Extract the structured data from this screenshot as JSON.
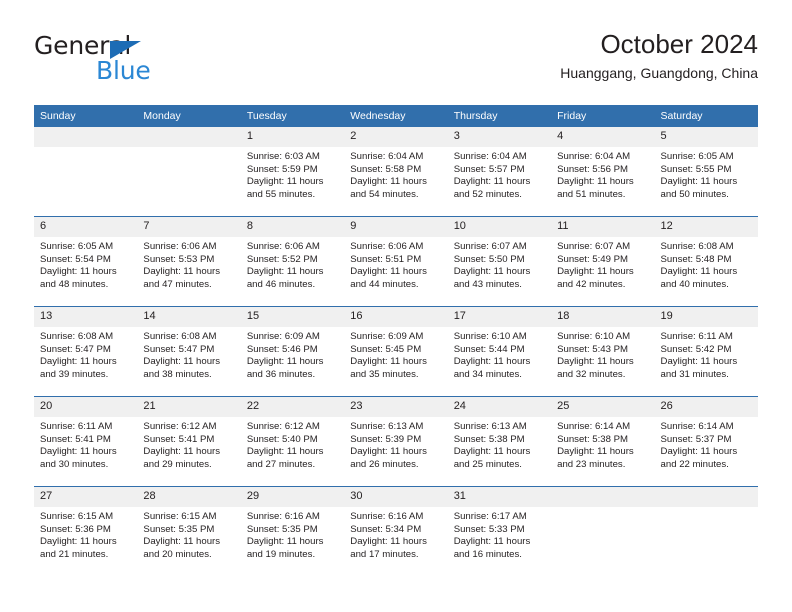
{
  "brand": {
    "name_part1": "General",
    "name_part2": "Blue",
    "flag_icon": "triangle-flag-icon"
  },
  "header": {
    "title": "October 2024",
    "subtitle": "Huanggang, Guangdong, China"
  },
  "calendar": {
    "weekday_headers": [
      "Sunday",
      "Monday",
      "Tuesday",
      "Wednesday",
      "Thursday",
      "Friday",
      "Saturday"
    ],
    "header_bg": "#316fac",
    "daynum_bg": "#f0f0f0",
    "grid_line": "#316fac",
    "labels": {
      "sunrise": "Sunrise:",
      "sunset": "Sunset:",
      "daylight": "Daylight:"
    },
    "weeks": [
      [
        {
          "day": "",
          "empty": true
        },
        {
          "day": "",
          "empty": true
        },
        {
          "day": "1",
          "sunrise": "Sunrise: 6:03 AM",
          "sunset": "Sunset: 5:59 PM",
          "daylight_1": "Daylight: 11 hours",
          "daylight_2": "and 55 minutes."
        },
        {
          "day": "2",
          "sunrise": "Sunrise: 6:04 AM",
          "sunset": "Sunset: 5:58 PM",
          "daylight_1": "Daylight: 11 hours",
          "daylight_2": "and 54 minutes."
        },
        {
          "day": "3",
          "sunrise": "Sunrise: 6:04 AM",
          "sunset": "Sunset: 5:57 PM",
          "daylight_1": "Daylight: 11 hours",
          "daylight_2": "and 52 minutes."
        },
        {
          "day": "4",
          "sunrise": "Sunrise: 6:04 AM",
          "sunset": "Sunset: 5:56 PM",
          "daylight_1": "Daylight: 11 hours",
          "daylight_2": "and 51 minutes."
        },
        {
          "day": "5",
          "sunrise": "Sunrise: 6:05 AM",
          "sunset": "Sunset: 5:55 PM",
          "daylight_1": "Daylight: 11 hours",
          "daylight_2": "and 50 minutes."
        }
      ],
      [
        {
          "day": "6",
          "sunrise": "Sunrise: 6:05 AM",
          "sunset": "Sunset: 5:54 PM",
          "daylight_1": "Daylight: 11 hours",
          "daylight_2": "and 48 minutes."
        },
        {
          "day": "7",
          "sunrise": "Sunrise: 6:06 AM",
          "sunset": "Sunset: 5:53 PM",
          "daylight_1": "Daylight: 11 hours",
          "daylight_2": "and 47 minutes."
        },
        {
          "day": "8",
          "sunrise": "Sunrise: 6:06 AM",
          "sunset": "Sunset: 5:52 PM",
          "daylight_1": "Daylight: 11 hours",
          "daylight_2": "and 46 minutes."
        },
        {
          "day": "9",
          "sunrise": "Sunrise: 6:06 AM",
          "sunset": "Sunset: 5:51 PM",
          "daylight_1": "Daylight: 11 hours",
          "daylight_2": "and 44 minutes."
        },
        {
          "day": "10",
          "sunrise": "Sunrise: 6:07 AM",
          "sunset": "Sunset: 5:50 PM",
          "daylight_1": "Daylight: 11 hours",
          "daylight_2": "and 43 minutes."
        },
        {
          "day": "11",
          "sunrise": "Sunrise: 6:07 AM",
          "sunset": "Sunset: 5:49 PM",
          "daylight_1": "Daylight: 11 hours",
          "daylight_2": "and 42 minutes."
        },
        {
          "day": "12",
          "sunrise": "Sunrise: 6:08 AM",
          "sunset": "Sunset: 5:48 PM",
          "daylight_1": "Daylight: 11 hours",
          "daylight_2": "and 40 minutes."
        }
      ],
      [
        {
          "day": "13",
          "sunrise": "Sunrise: 6:08 AM",
          "sunset": "Sunset: 5:47 PM",
          "daylight_1": "Daylight: 11 hours",
          "daylight_2": "and 39 minutes."
        },
        {
          "day": "14",
          "sunrise": "Sunrise: 6:08 AM",
          "sunset": "Sunset: 5:47 PM",
          "daylight_1": "Daylight: 11 hours",
          "daylight_2": "and 38 minutes."
        },
        {
          "day": "15",
          "sunrise": "Sunrise: 6:09 AM",
          "sunset": "Sunset: 5:46 PM",
          "daylight_1": "Daylight: 11 hours",
          "daylight_2": "and 36 minutes."
        },
        {
          "day": "16",
          "sunrise": "Sunrise: 6:09 AM",
          "sunset": "Sunset: 5:45 PM",
          "daylight_1": "Daylight: 11 hours",
          "daylight_2": "and 35 minutes."
        },
        {
          "day": "17",
          "sunrise": "Sunrise: 6:10 AM",
          "sunset": "Sunset: 5:44 PM",
          "daylight_1": "Daylight: 11 hours",
          "daylight_2": "and 34 minutes."
        },
        {
          "day": "18",
          "sunrise": "Sunrise: 6:10 AM",
          "sunset": "Sunset: 5:43 PM",
          "daylight_1": "Daylight: 11 hours",
          "daylight_2": "and 32 minutes."
        },
        {
          "day": "19",
          "sunrise": "Sunrise: 6:11 AM",
          "sunset": "Sunset: 5:42 PM",
          "daylight_1": "Daylight: 11 hours",
          "daylight_2": "and 31 minutes."
        }
      ],
      [
        {
          "day": "20",
          "sunrise": "Sunrise: 6:11 AM",
          "sunset": "Sunset: 5:41 PM",
          "daylight_1": "Daylight: 11 hours",
          "daylight_2": "and 30 minutes."
        },
        {
          "day": "21",
          "sunrise": "Sunrise: 6:12 AM",
          "sunset": "Sunset: 5:41 PM",
          "daylight_1": "Daylight: 11 hours",
          "daylight_2": "and 29 minutes."
        },
        {
          "day": "22",
          "sunrise": "Sunrise: 6:12 AM",
          "sunset": "Sunset: 5:40 PM",
          "daylight_1": "Daylight: 11 hours",
          "daylight_2": "and 27 minutes."
        },
        {
          "day": "23",
          "sunrise": "Sunrise: 6:13 AM",
          "sunset": "Sunset: 5:39 PM",
          "daylight_1": "Daylight: 11 hours",
          "daylight_2": "and 26 minutes."
        },
        {
          "day": "24",
          "sunrise": "Sunrise: 6:13 AM",
          "sunset": "Sunset: 5:38 PM",
          "daylight_1": "Daylight: 11 hours",
          "daylight_2": "and 25 minutes."
        },
        {
          "day": "25",
          "sunrise": "Sunrise: 6:14 AM",
          "sunset": "Sunset: 5:38 PM",
          "daylight_1": "Daylight: 11 hours",
          "daylight_2": "and 23 minutes."
        },
        {
          "day": "26",
          "sunrise": "Sunrise: 6:14 AM",
          "sunset": "Sunset: 5:37 PM",
          "daylight_1": "Daylight: 11 hours",
          "daylight_2": "and 22 minutes."
        }
      ],
      [
        {
          "day": "27",
          "sunrise": "Sunrise: 6:15 AM",
          "sunset": "Sunset: 5:36 PM",
          "daylight_1": "Daylight: 11 hours",
          "daylight_2": "and 21 minutes."
        },
        {
          "day": "28",
          "sunrise": "Sunrise: 6:15 AM",
          "sunset": "Sunset: 5:35 PM",
          "daylight_1": "Daylight: 11 hours",
          "daylight_2": "and 20 minutes."
        },
        {
          "day": "29",
          "sunrise": "Sunrise: 6:16 AM",
          "sunset": "Sunset: 5:35 PM",
          "daylight_1": "Daylight: 11 hours",
          "daylight_2": "and 19 minutes."
        },
        {
          "day": "30",
          "sunrise": "Sunrise: 6:16 AM",
          "sunset": "Sunset: 5:34 PM",
          "daylight_1": "Daylight: 11 hours",
          "daylight_2": "and 17 minutes."
        },
        {
          "day": "31",
          "sunrise": "Sunrise: 6:17 AM",
          "sunset": "Sunset: 5:33 PM",
          "daylight_1": "Daylight: 11 hours",
          "daylight_2": "and 16 minutes."
        },
        {
          "day": "",
          "empty": true
        },
        {
          "day": "",
          "empty": true
        }
      ]
    ]
  }
}
